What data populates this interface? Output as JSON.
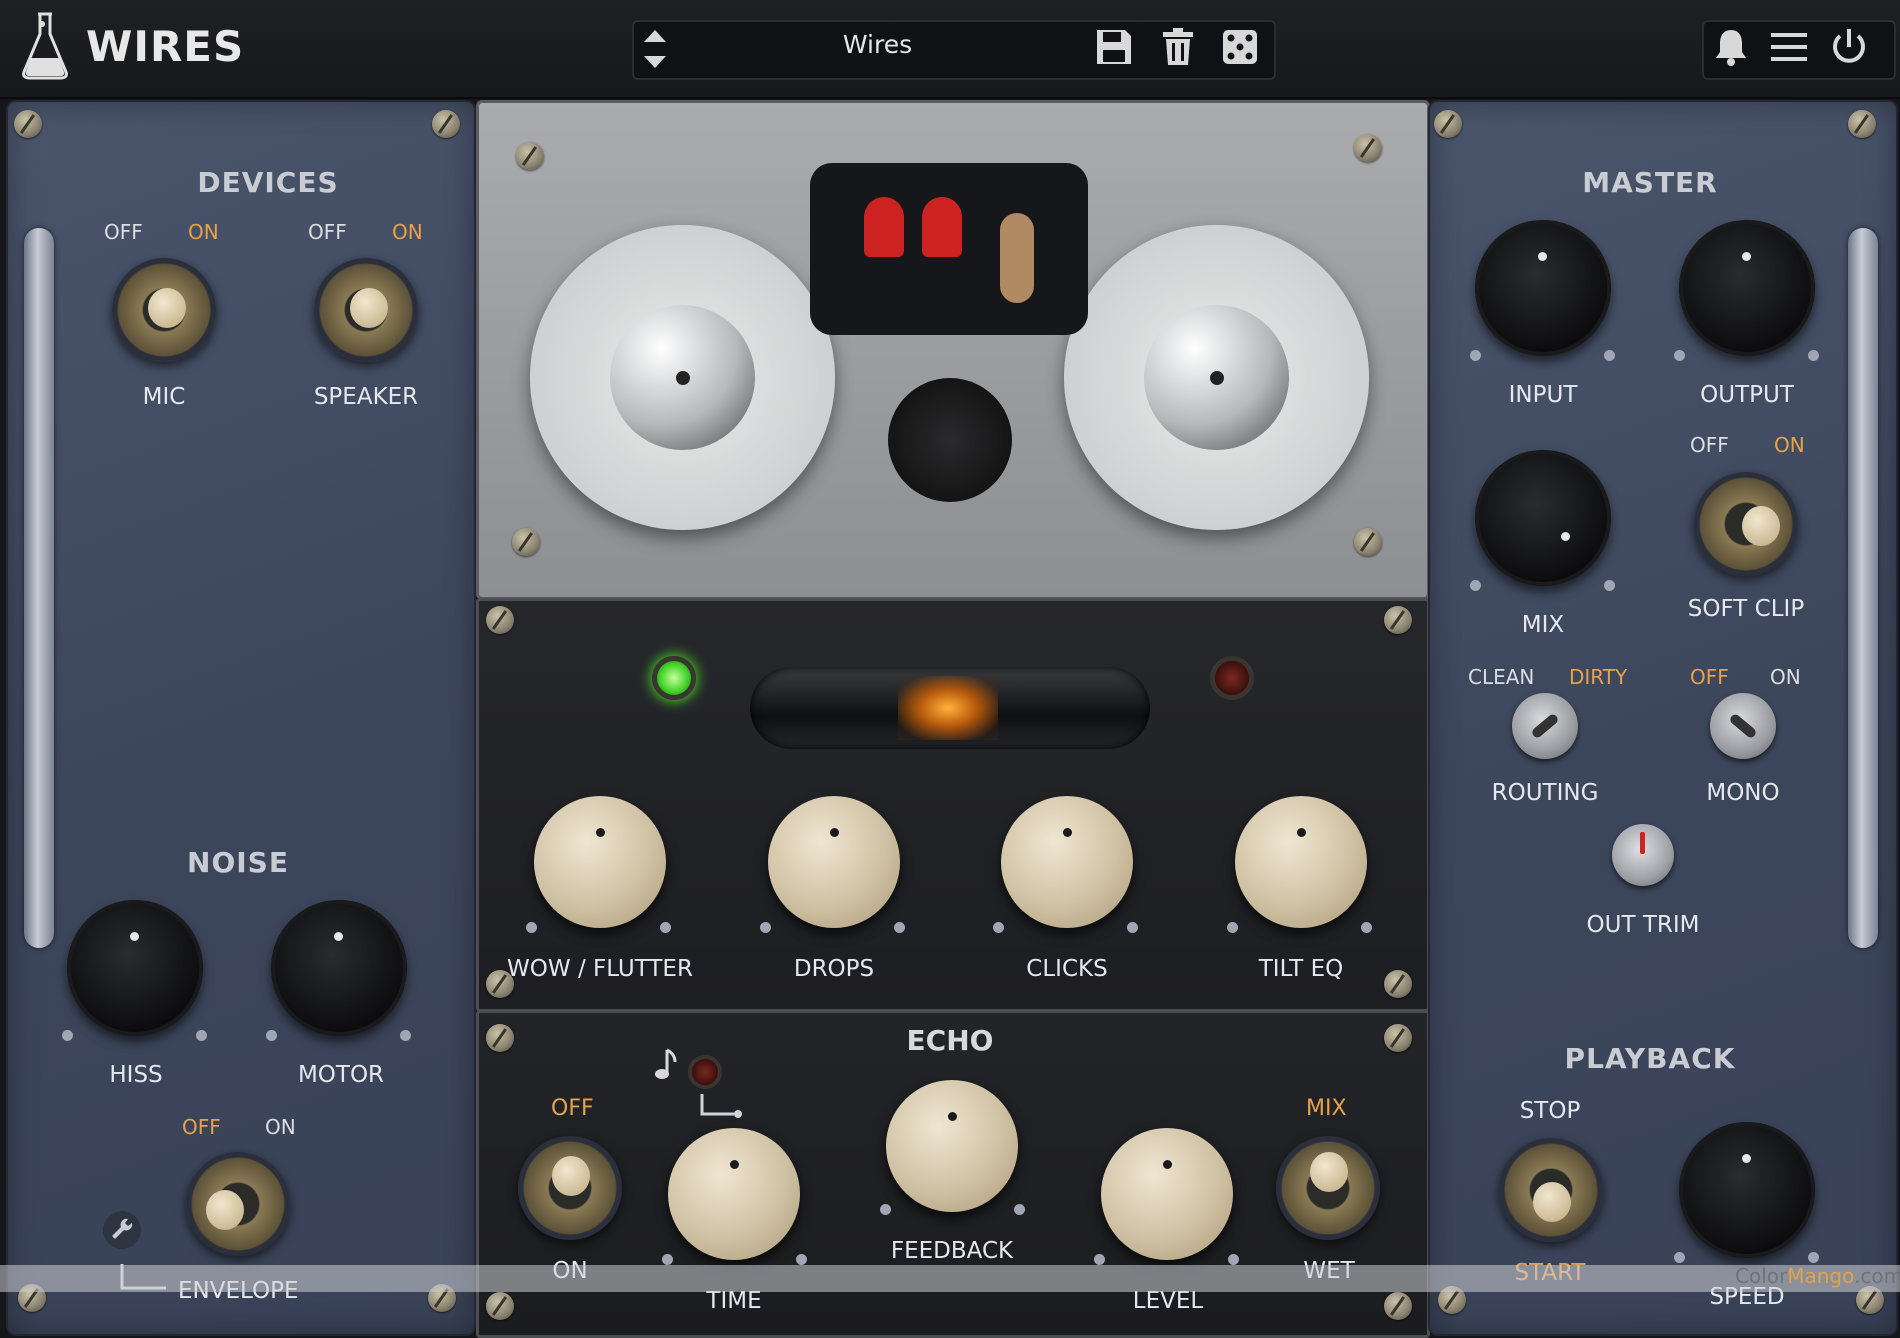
{
  "header": {
    "app_title": "WIRES",
    "preset_name": "Wires"
  },
  "icons": {
    "logo": "flask-icon",
    "preset_nav": "up-down-arrows-icon",
    "save": "save-icon",
    "delete": "trash-icon",
    "random": "dice-icon",
    "notifications": "bell-icon",
    "menu": "hamburger-menu-icon",
    "power": "power-icon",
    "settings": "wrench-icon",
    "note": "music-note-icon"
  },
  "devices": {
    "title": "DEVICES",
    "mic": {
      "off": "OFF",
      "on": "ON",
      "label": "MIC"
    },
    "speaker": {
      "off": "OFF",
      "on": "ON",
      "label": "SPEAKER"
    }
  },
  "noise": {
    "title": "NOISE",
    "hiss": "HISS",
    "motor": "MOTOR",
    "envelope": {
      "off": "OFF",
      "on": "ON",
      "label": "ENVELOPE"
    }
  },
  "fx": {
    "wow_flutter": "WOW / FLUTTER",
    "drops": "DROPS",
    "clicks": "CLICKS",
    "tilt_eq": "TILT EQ"
  },
  "echo": {
    "title": "ECHO",
    "toggle_off": "OFF",
    "toggle_on": "ON",
    "time": "TIME",
    "feedback": "FEEDBACK",
    "level": "LEVEL",
    "mix": "MIX",
    "wet": "WET"
  },
  "master": {
    "title": "MASTER",
    "input": "INPUT",
    "output": "OUTPUT",
    "mix": "MIX",
    "soft_clip": {
      "off": "OFF",
      "on": "ON",
      "label": "SOFT CLIP"
    },
    "routing": {
      "clean": "CLEAN",
      "dirty": "DIRTY",
      "label": "ROUTING"
    },
    "mono": {
      "off": "OFF",
      "on": "ON",
      "label": "MONO"
    },
    "out_trim": "OUT TRIM"
  },
  "playback": {
    "title": "PLAYBACK",
    "stop": "STOP",
    "start": "START",
    "speed": "SPEED"
  },
  "watermark": {
    "prefix": "Color",
    "middle": "Mango",
    "suffix": ".com"
  },
  "colors": {
    "accent_on": "#e6a24a",
    "panel": "#445068",
    "led_green": "#3ecf25"
  }
}
